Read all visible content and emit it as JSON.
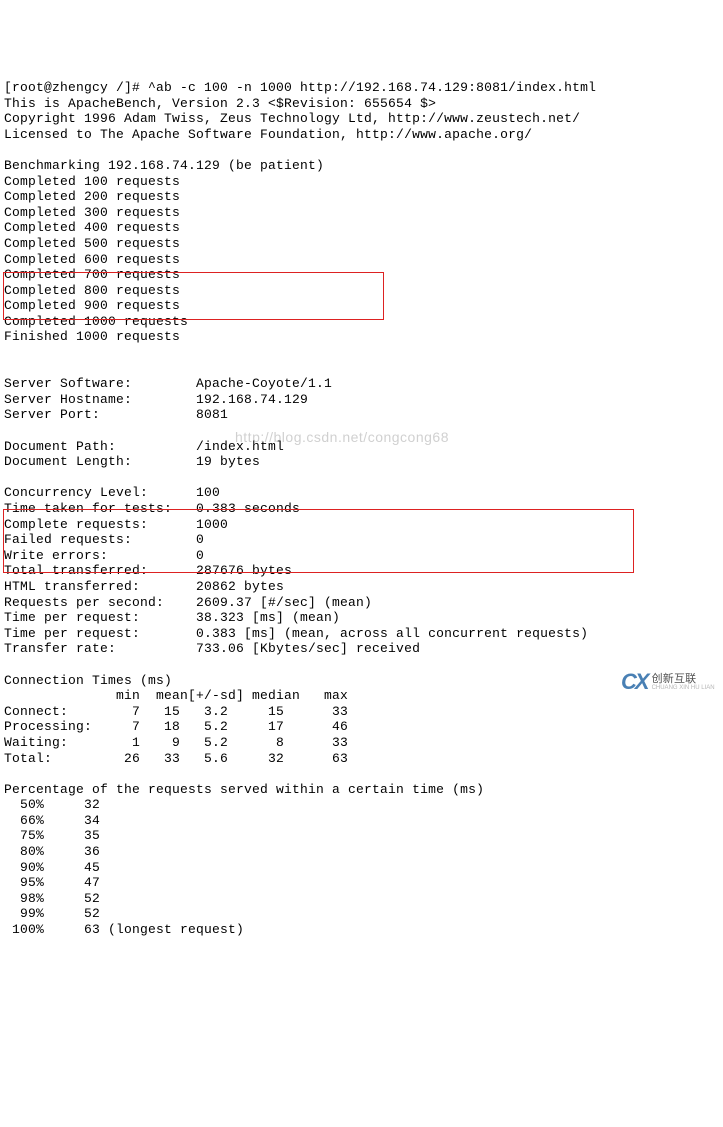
{
  "header": {
    "prompt_line": "[root@zhengcy /]# ^ab -c 100 -n 1000 http://192.168.74.129:8081/index.html",
    "apache_line": "This is ApacheBench, Version 2.3 <$Revision: 655654 $>",
    "copyright_line": "Copyright 1996 Adam Twiss, Zeus Technology Ltd, http://www.zeustech.net/",
    "license_line": "Licensed to The Apache Software Foundation, http://www.apache.org/"
  },
  "benchmarking": {
    "title": "Benchmarking 192.168.74.129 (be patient)",
    "progress": [
      "Completed 100 requests",
      "Completed 200 requests",
      "Completed 300 requests",
      "Completed 400 requests",
      "Completed 500 requests",
      "Completed 600 requests",
      "Completed 700 requests",
      "Completed 800 requests",
      "Completed 900 requests",
      "Completed 1000 requests",
      "Finished 1000 requests"
    ]
  },
  "server_block": {
    "software": "Server Software:        Apache-Coyote/1.1",
    "hostname": "Server Hostname:        192.168.74.129",
    "port": "Server Port:            8081"
  },
  "doc_block": {
    "path": "Document Path:          /index.html",
    "length": "Document Length:        19 bytes"
  },
  "stats_block": {
    "concurrency": "Concurrency Level:      100",
    "time_taken": "Time taken for tests:   0.383 seconds",
    "complete": "Complete requests:      1000",
    "failed": "Failed requests:        0",
    "write_err": "Write errors:           0",
    "total_xfer": "Total transferred:      287676 bytes",
    "html_xfer": "HTML transferred:       20862 bytes"
  },
  "rate_block": {
    "rps": "Requests per second:    2609.37 [#/sec] (mean)",
    "tpr1": "Time per request:       38.323 [ms] (mean)",
    "tpr2": "Time per request:       0.383 [ms] (mean, across all concurrent requests)",
    "trate": "Transfer rate:          733.06 [Kbytes/sec] received"
  },
  "conn_times": {
    "title": "Connection Times (ms)",
    "header": "              min  mean[+/-sd] median   max",
    "rows": [
      "Connect:        7   15   3.2     15      33",
      "Processing:     7   18   5.2     17      46",
      "Waiting:        1    9   5.2      8      33",
      "Total:         26   33   5.6     32      63"
    ]
  },
  "percentiles": {
    "title": "Percentage of the requests served within a certain time (ms)",
    "rows": [
      "  50%     32",
      "  66%     34",
      "  75%     35",
      "  80%     36",
      "  90%     45",
      "  95%     47",
      "  98%     52",
      "  99%     52",
      " 100%     63 (longest request)"
    ]
  },
  "watermark": "http://blog.csdn.net/congcong68",
  "logo": {
    "mark": "CX",
    "name": "创新互联",
    "sub": "CHUANG XIN HU LIAN"
  }
}
